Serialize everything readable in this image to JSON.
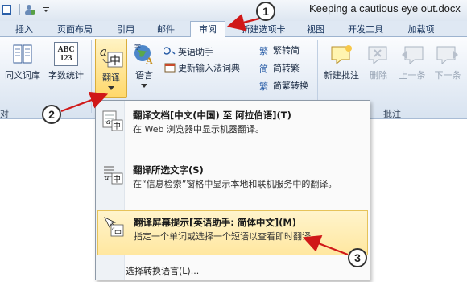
{
  "title": {
    "document": "Keeping a cautious eye out.docx"
  },
  "tabs": [
    {
      "label": "插入",
      "active": false
    },
    {
      "label": "页面布局",
      "active": false
    },
    {
      "label": "引用",
      "active": false
    },
    {
      "label": "邮件",
      "active": false
    },
    {
      "label": "审阅",
      "active": true
    },
    {
      "label": "新建选项卡",
      "active": false
    },
    {
      "label": "视图",
      "active": false
    },
    {
      "label": "开发工具",
      "active": false
    },
    {
      "label": "加载项",
      "active": false
    }
  ],
  "ribbon": {
    "proofing": {
      "thesaurus": "同义词库",
      "word_count": "字数统计",
      "group_label_partial": "对"
    },
    "language": {
      "translate": "翻译",
      "language_btn": "语言",
      "english_assistant": "英语助手",
      "update_ime": "更新输入法词典"
    },
    "chinese_conversion": {
      "to_simplified": "繁转简",
      "to_traditional": "简转繁",
      "convert": "简繁转换"
    },
    "comments": {
      "new_comment": "新建批注",
      "delete": "删除",
      "previous": "上一条",
      "next": "下一条",
      "group_label": "批注"
    },
    "abc_icon_text": {
      "line1": "ABC",
      "line2": "123"
    }
  },
  "menu": {
    "items": [
      {
        "title": "翻译文档[中文(中国) 至 阿拉伯语](T)",
        "desc": "在 Web 浏览器中显示机器翻译。",
        "highlighted": false
      },
      {
        "title": "翻译所选文字(S)",
        "desc": "在“信息检索”窗格中显示本地和联机服务中的翻译。",
        "highlighted": false
      },
      {
        "title": "翻译屏幕提示[英语助手: 简体中文](M)",
        "desc": "指定一个单词或选择一个短语以查看即时翻译。",
        "highlighted": true
      }
    ],
    "footer": "选择转换语言(L)..."
  },
  "callouts": {
    "one": "1",
    "two": "2",
    "three": "3"
  },
  "colors": {
    "accent": "#ffd86a",
    "highlight": "#ffe7a0",
    "arrow": "#d01818",
    "ribbon_bg": "#e2eaf4"
  }
}
